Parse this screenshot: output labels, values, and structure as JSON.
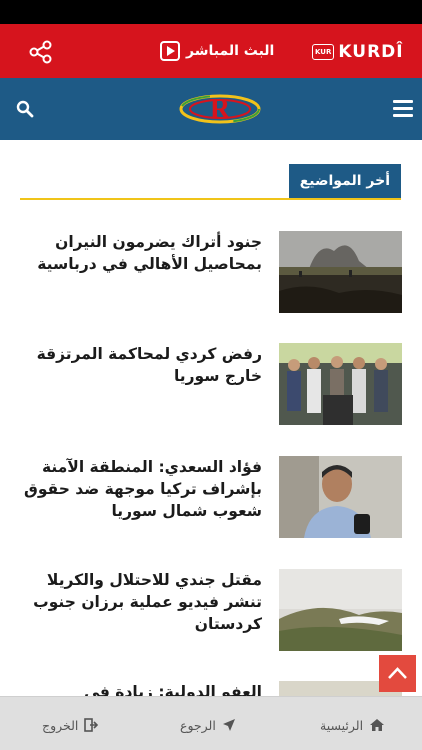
{
  "top_bar": {
    "lang_code": "KUR",
    "lang_name": "KURDÎ",
    "live_label": "البث المباشر"
  },
  "header": {
    "logo_letter": "R"
  },
  "section": {
    "title": "أخر المواضيع"
  },
  "news": [
    {
      "title": "جنود أتراك يضرمون النيران بمحاصيل الأهالي في درباسية",
      "thumb_icon": "field-fire-photo"
    },
    {
      "title": "رفض كردي لمحاكمة المرتزقة خارج سوريا",
      "thumb_icon": "press-conference-photo"
    },
    {
      "title": "فؤاد السعدي: المنطقة الآمنة بإشراف تركيا موجهة ضد حقوق شعوب شمال سوريا",
      "thumb_icon": "speaker-portrait-photo"
    },
    {
      "title": "مقتل جندي للاحتلال والكريلا تنشر فيديو عملية برزان جنوب كردستان",
      "thumb_icon": "mountain-landscape-photo"
    },
    {
      "title": "العفو الدولية: زيادة في اضطهاد",
      "thumb_icon": "outdoor-photo"
    }
  ],
  "bottom_nav": {
    "home": "الرئيسية",
    "back": "الرجوع",
    "exit": "الخروج"
  },
  "colors": {
    "red": "#d6141d",
    "blue": "#1e5a86",
    "accent_line": "#f0c419",
    "scroll_top": "#e34a3e"
  }
}
